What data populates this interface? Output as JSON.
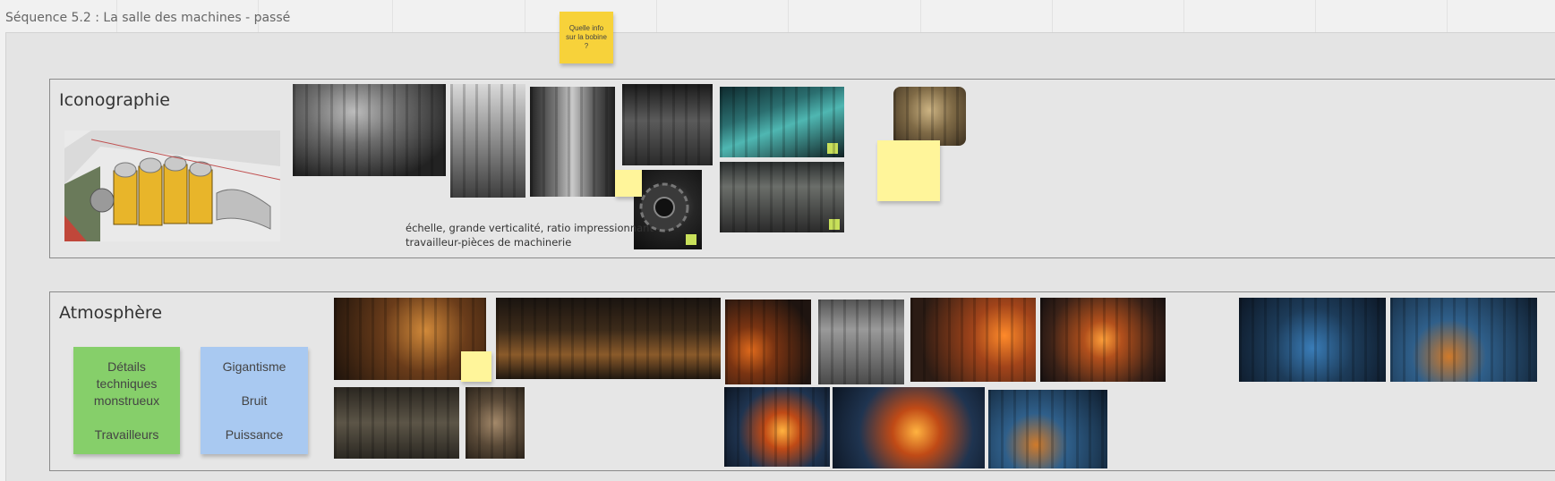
{
  "board": {
    "title": "Séquence 5.2 : La salle des machines - passé"
  },
  "top_sticky": {
    "text": "Quelle info\nsur la bobine\n?",
    "color": "#f7d23a"
  },
  "sections": {
    "iconographie": {
      "title": "Iconographie",
      "note": "échelle, grande verticalité, ratio impressionnant\ntravailleur-pièces de machinerie"
    },
    "atmosphere": {
      "title": "Atmosphère",
      "sticky_green": {
        "text": "Détails\ntechniques\nmonstrueux\n\nTravailleurs",
        "color": "#86cf6a"
      },
      "sticky_blue": {
        "text": "Gigantisme\n\nBruit\n\nPuissance",
        "color": "#a9c9f1"
      }
    }
  },
  "colors": {
    "canvas_bg": "#f1f1f1",
    "frame_bg": "#e4e4e4",
    "section_border": "#8a8a8a",
    "small_yellow_sticky": "#fff59a",
    "lime_marker": "#c8e05a"
  }
}
